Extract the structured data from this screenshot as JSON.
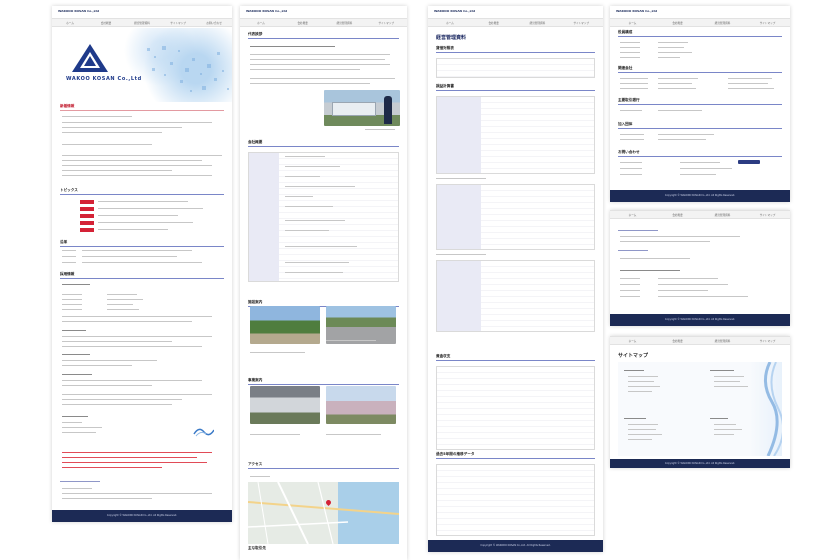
{
  "site": {
    "brand_small": "WAKODO KOSAN Co.,Ltd",
    "logo_text": "WAKOO KOSAN Co.,Ltd",
    "footer_text": "Copyright © WAKODO KOSAN Co.,Ltd. All Rights Reserved."
  },
  "nav_items": [
    "ホーム",
    "会社概要",
    "経営管理資料",
    "サイトマップ",
    "お問い合わせ"
  ],
  "pages": {
    "home": {
      "sec_news": "新着情報",
      "sec_topics": "トピックス",
      "sec_history": "沿革",
      "sec_recruit": "採用情報"
    },
    "company": {
      "sec_greeting": "代表挨拶",
      "sec_profile": "会社概要",
      "sec_facilities": "施設案内",
      "sec_business": "事業案内",
      "sec_access": "アクセス",
      "sec_extra": "主な取引先"
    },
    "management": {
      "title": "経営管理資料",
      "sec_balance": "貸借対照表",
      "sec_income": "損益計算書",
      "sec_cashflow": "資金収支",
      "sec_summary": "過去5年間の推移データ"
    },
    "right_top": {
      "sec_one": "役員構成",
      "sec_two": "関連会社",
      "sec_three": "主要取引銀行",
      "sec_four": "加入団体",
      "sec_five": "お問い合わせ"
    },
    "sitemap": {
      "title": "サイトマップ"
    }
  },
  "colors": {
    "accent": "#2c3c82",
    "heading_rule": "#7a86c8",
    "alert_red": "#d42236",
    "footer_bg": "#1c2a55"
  }
}
